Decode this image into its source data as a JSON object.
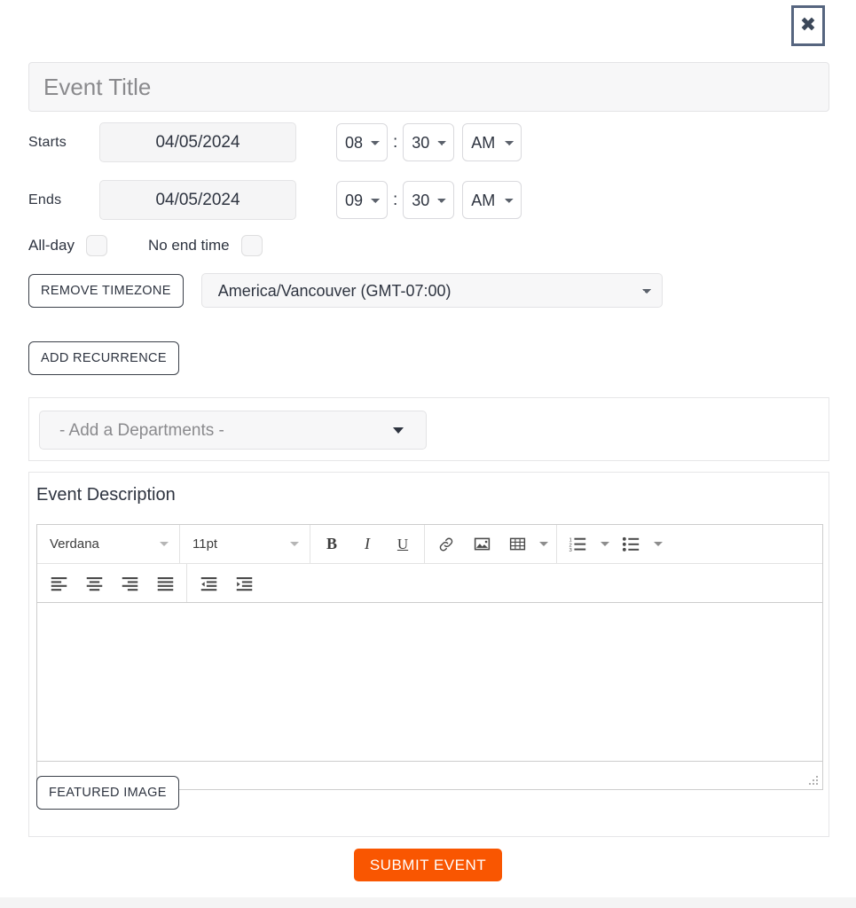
{
  "dialog": {
    "close_label": "✖",
    "close_icon": "close-icon"
  },
  "event_title": {
    "placeholder": "Event Title",
    "value": ""
  },
  "starts": {
    "label": "Starts",
    "date": "04/05/2024",
    "hour": "08",
    "minute": "30",
    "meridiem": "AM",
    "separator": ":"
  },
  "ends": {
    "label": "Ends",
    "date": "04/05/2024",
    "hour": "09",
    "minute": "30",
    "meridiem": "AM",
    "separator": ":"
  },
  "options": {
    "all_day_label": "All-day",
    "no_end_time_label": "No end time"
  },
  "timezone": {
    "remove_button": "REMOVE TIMEZONE",
    "selected": "America/Vancouver (GMT-07:00)"
  },
  "recurrence": {
    "add_button": "ADD RECURRENCE"
  },
  "departments": {
    "placeholder": "- Add a Departments -"
  },
  "description": {
    "heading": "Event Description",
    "body": "",
    "toolbar": {
      "font_family": "Verdana",
      "font_size": "11pt",
      "bold": "B",
      "italic": "I",
      "underline": "U",
      "link_icon": "link-icon",
      "image_icon": "image-icon",
      "table_icon": "table-icon",
      "numbered_list_icon": "numbered-list-icon",
      "bullet_list_icon": "bullet-list-icon",
      "align_left_icon": "align-left-icon",
      "align_center_icon": "align-center-icon",
      "align_right_icon": "align-right-icon",
      "align_justify_icon": "align-justify-icon",
      "outdent_icon": "outdent-icon",
      "indent_icon": "indent-icon",
      "resize_grip_icon": "resize-grip-icon"
    }
  },
  "featured_image": {
    "button": "FEATURED IMAGE"
  },
  "submit": {
    "label": "SUBMIT EVENT"
  },
  "colors": {
    "accent_orange": "#f95601",
    "close_border": "#56657f",
    "field_bg": "#f7f7f8",
    "text": "#2e3440"
  }
}
